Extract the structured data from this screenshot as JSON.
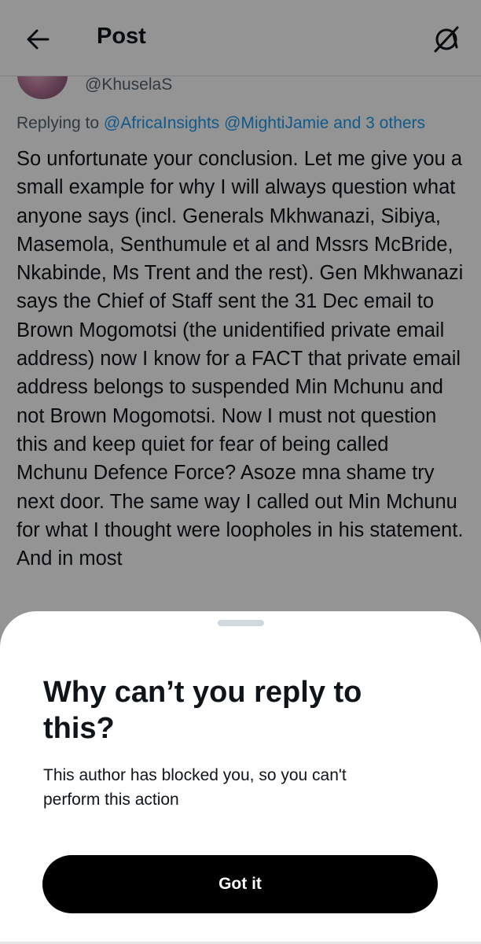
{
  "header": {
    "title": "Post",
    "back_icon": "arrow-left-icon",
    "grok_icon": "grok-icon"
  },
  "post": {
    "handle": "@KhuselaS",
    "replying_prefix": "Replying to",
    "replying_mentions": "@AfricaInsights @MightiJamie and 3 others",
    "text": "So unfortunate your conclusion. Let me give you a small example for why I will always question what anyone says (incl. Generals Mkhwanazi, Sibiya, Masemola, Senthumule et al and Mssrs McBride, Nkabinde, Ms Trent and the rest). Gen Mkhwanazi says the Chief of Staff sent the 31 Dec email to Brown Mogomotsi (the unidentified private email address) now I know for a FACT that private email address belongs to suspended Min Mchunu and not Brown Mogomotsi. Now I must not question this and keep quiet for fear of being called Mchunu Defence Force? Asoze mna shame try next door. The same way I called out Min Mchunu for what I thought were loopholes in his statement. And in most"
  },
  "sheet": {
    "title": "Why can’t you reply to this?",
    "body": "This author has blocked you, so you can't perform this action",
    "button_label": "Got it"
  },
  "colors": {
    "link": "#1d9bf0",
    "secondary_text": "#536471",
    "primary_text": "#0f1419",
    "button_bg": "#000000",
    "overlay": "rgba(0,0,0,0.42)"
  }
}
